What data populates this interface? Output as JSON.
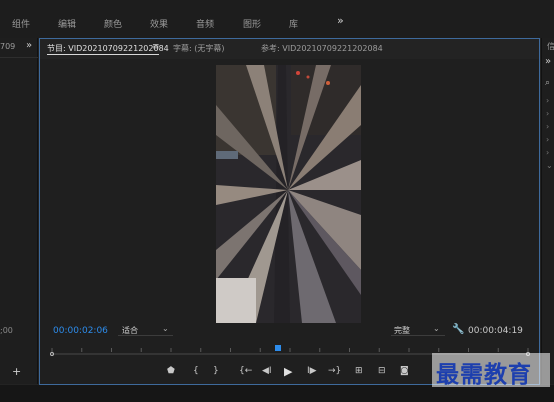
{
  "menu": {
    "items": [
      "组件",
      "编辑",
      "颜色",
      "效果",
      "音频",
      "图形",
      "库"
    ],
    "overflow": "»"
  },
  "left_panel": {
    "top_text": "709",
    "overflow": "»",
    "timecode": ";00"
  },
  "right_panel": {
    "top_text": "信",
    "overflow": "»"
  },
  "monitor": {
    "tabs": [
      {
        "label": "节目: VID20210709221202084",
        "active": true
      },
      {
        "label": "字幕: (无字幕)",
        "active": false
      },
      {
        "label": "参考: VID20210709221202084",
        "active": false
      }
    ],
    "tab_menu": "≡",
    "tab_overflow": "»",
    "current_timecode": "00:00:02:06",
    "zoom": "适合",
    "resolution": "完整",
    "duration": "00:00:04:19",
    "playhead_fraction": 0.475
  },
  "colors": {
    "accent_blue": "#2d8ceb",
    "panel_border": "#3e6a9c"
  },
  "watermark": "最需教育"
}
